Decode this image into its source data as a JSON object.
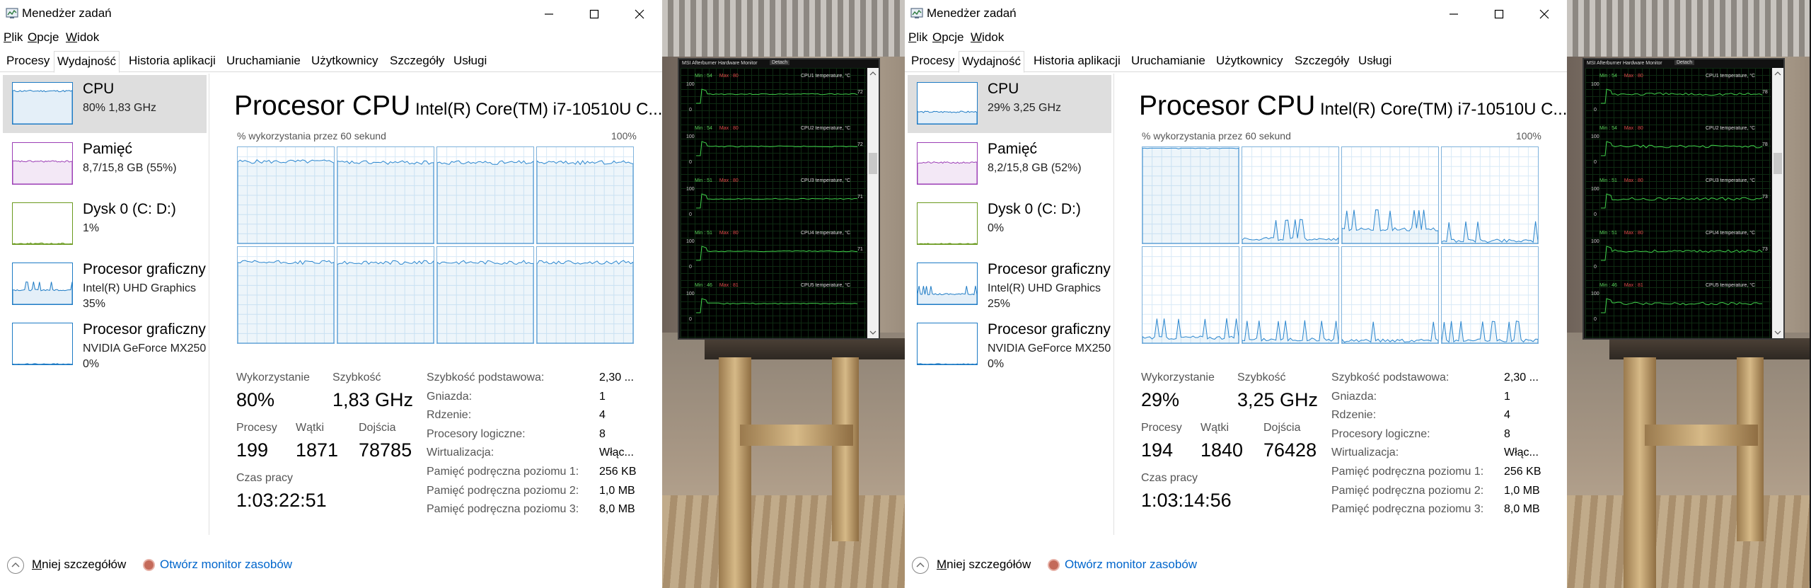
{
  "screens": [
    {
      "window_title": "Menedżer zadań",
      "menu": [
        "Plik",
        "Opcje",
        "Widok"
      ],
      "tabs": [
        "Procesy",
        "Wydajność",
        "Historia aplikacji",
        "Uruchamianie",
        "Użytkownicy",
        "Szczegóły",
        "Usługi"
      ],
      "active_tab": "Wydajność",
      "sidebar": [
        {
          "name": "CPU",
          "line1": "80% 1,83 GHz",
          "line2": "",
          "color": "#1e7bc5",
          "level": 0.8
        },
        {
          "name": "Pamięć",
          "line1": "8,7/15,8 GB (55%)",
          "line2": "",
          "color": "#9c3eb6",
          "level": 0.55
        },
        {
          "name": "Dysk 0 (C: D:)",
          "line1": "1%",
          "line2": "",
          "color": "#6a9a1e",
          "level": 0.01
        },
        {
          "name": "Procesor graficzny",
          "line1": "Intel(R) UHD Graphics",
          "line2": "35%",
          "color": "#1e7bc5",
          "level": 0.35
        },
        {
          "name": "Procesor graficzny",
          "line1": "NVIDIA GeForce MX250",
          "line2": "0%",
          "color": "#1e7bc5",
          "level": 0.0
        }
      ],
      "cpu_title": "Procesor CPU",
      "cpu_model": "Intel(R) Core(TM) i7-10510U C...",
      "graph_caption": "% wykorzystania przez 60 sekund",
      "graph_max": "100%",
      "core_levels": [
        0.85,
        0.84,
        0.84,
        0.84,
        0.84,
        0.84,
        0.84,
        0.84
      ],
      "stats": {
        "util_label": "Wykorzystanie",
        "util_value": "80%",
        "speed_label": "Szybkość",
        "speed_value": "1,83 GHz",
        "proc_label": "Procesy",
        "proc_value": "199",
        "threads_label": "Wątki",
        "threads_value": "1871",
        "handles_label": "Dojścia",
        "handles_value": "78785",
        "uptime_label": "Czas pracy",
        "uptime_value": "1:03:22:51"
      },
      "specs": [
        {
          "label": "Szybkość podstawowa:",
          "value": "2,30 ..."
        },
        {
          "label": "Gniazda:",
          "value": "1"
        },
        {
          "label": "Rdzenie:",
          "value": "4"
        },
        {
          "label": "Procesory logiczne:",
          "value": "8"
        },
        {
          "label": "Wirtualizacja:",
          "value": "Włąc..."
        },
        {
          "label": "Pamięć podręczna poziomu 1:",
          "value": "256 KB"
        },
        {
          "label": "Pamięć podręczna poziomu 2:",
          "value": "1,0 MB"
        },
        {
          "label": "Pamięć podręczna poziomu 3:",
          "value": "8,0 MB"
        }
      ],
      "footer": {
        "less": "Mniej szczegółów",
        "monitor": "Otwórz monitor zasobów"
      },
      "msi": {
        "title": "MSI Afterburner Hardware Monitor",
        "detach": "Detach",
        "rows": [
          {
            "minmax_min": "Min : 54",
            "minmax_max": "Max : 80",
            "label": "CPU1 temperature, °C",
            "cur": "72"
          },
          {
            "minmax_min": "Min : 54",
            "minmax_max": "Max : 80",
            "label": "CPU2 temperature, °C",
            "cur": "72"
          },
          {
            "minmax_min": "Min : 51",
            "minmax_max": "Max : 80",
            "label": "CPU3 temperature, °C",
            "cur": "71"
          },
          {
            "minmax_min": "Min : 51",
            "minmax_max": "Max : 80",
            "label": "CPU4 temperature, °C",
            "cur": "71"
          },
          {
            "minmax_min": "Min : 46",
            "minmax_max": "Max : 81",
            "label": "CPU5 temperature, °C",
            "cur": ""
          }
        ]
      }
    },
    {
      "window_title": "Menedżer zadań",
      "menu": [
        "Plik",
        "Opcje",
        "Widok"
      ],
      "tabs": [
        "Procesy",
        "Wydajność",
        "Historia aplikacji",
        "Uruchamianie",
        "Użytkownicy",
        "Szczegóły",
        "Usługi"
      ],
      "active_tab": "Wydajność",
      "sidebar": [
        {
          "name": "CPU",
          "line1": "29% 3,25 GHz",
          "line2": "",
          "color": "#1e7bc5",
          "level": 0.29
        },
        {
          "name": "Pamięć",
          "line1": "8,2/15,8 GB (52%)",
          "line2": "",
          "color": "#9c3eb6",
          "level": 0.52
        },
        {
          "name": "Dysk 0 (C: D:)",
          "line1": "0%",
          "line2": "",
          "color": "#6a9a1e",
          "level": 0.0
        },
        {
          "name": "Procesor graficzny",
          "line1": "Intel(R) UHD Graphics",
          "line2": "25%",
          "color": "#1e7bc5",
          "level": 0.25
        },
        {
          "name": "Procesor graficzny",
          "line1": "NVIDIA GeForce MX250",
          "line2": "0%",
          "color": "#1e7bc5",
          "level": 0.0
        }
      ],
      "cpu_title": "Procesor CPU",
      "cpu_model": "Intel(R) Core(TM) i7-10510U C...",
      "graph_caption": "% wykorzystania przez 60 sekund",
      "graph_max": "100%",
      "core_levels": [
        1.0,
        0.05,
        0.15,
        0.03,
        0.06,
        0.04,
        0.03,
        0.03
      ],
      "stats": {
        "util_label": "Wykorzystanie",
        "util_value": "29%",
        "speed_label": "Szybkość",
        "speed_value": "3,25 GHz",
        "proc_label": "Procesy",
        "proc_value": "194",
        "threads_label": "Wątki",
        "threads_value": "1840",
        "handles_label": "Dojścia",
        "handles_value": "76428",
        "uptime_label": "Czas pracy",
        "uptime_value": "1:03:14:56"
      },
      "specs": [
        {
          "label": "Szybkość podstawowa:",
          "value": "2,30 ..."
        },
        {
          "label": "Gniazda:",
          "value": "1"
        },
        {
          "label": "Rdzenie:",
          "value": "4"
        },
        {
          "label": "Procesory logiczne:",
          "value": "8"
        },
        {
          "label": "Wirtualizacja:",
          "value": "Włąc..."
        },
        {
          "label": "Pamięć podręczna poziomu 1:",
          "value": "256 KB"
        },
        {
          "label": "Pamięć podręczna poziomu 2:",
          "value": "1,0 MB"
        },
        {
          "label": "Pamięć podręczna poziomu 3:",
          "value": "8,0 MB"
        }
      ],
      "footer": {
        "less": "Mniej szczegółów",
        "monitor": "Otwórz monitor zasobów"
      },
      "msi": {
        "title": "MSI Afterburner Hardware Monitor",
        "detach": "Detach",
        "rows": [
          {
            "minmax_min": "Min : 54",
            "minmax_max": "Max : 80",
            "label": "CPU1 temperature, °C",
            "cur": "78"
          },
          {
            "minmax_min": "Min : 54",
            "minmax_max": "Max : 80",
            "label": "CPU2 temperature, °C",
            "cur": "78"
          },
          {
            "minmax_min": "Min : 51",
            "minmax_max": "Max : 80",
            "label": "CPU3 temperature, °C",
            "cur": "73"
          },
          {
            "minmax_min": "Min : 51",
            "minmax_max": "Max : 80",
            "label": "CPU4 temperature, °C",
            "cur": "73"
          },
          {
            "minmax_min": "Min : 46",
            "minmax_max": "Max : 81",
            "label": "CPU5 temperature, °C",
            "cur": ""
          }
        ]
      }
    }
  ]
}
